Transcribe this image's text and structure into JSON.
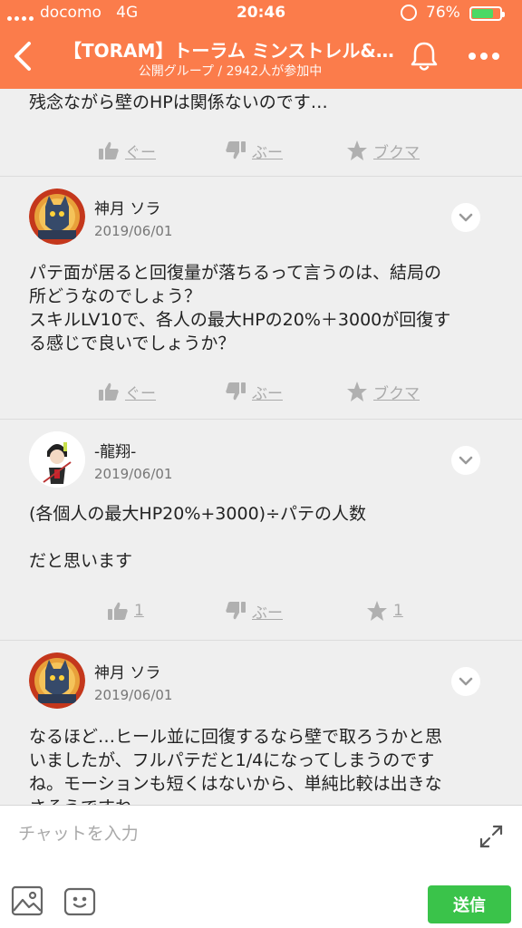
{
  "status": {
    "carrier": "docomo",
    "network": "4G",
    "time": "20:46",
    "battery": "76%",
    "battery_level": 0.76
  },
  "header": {
    "title": "【TORAM】トーラム ミンストレル&…",
    "subtitle": "公開グループ / 2942人が参加中"
  },
  "posts": [
    {
      "body": "残念ながら壁のHPは関係ないのです…",
      "actions": {
        "like": "ぐー",
        "dislike": "ぶー",
        "bookmark": "ブクマ"
      }
    },
    {
      "author": "神月 ソラ",
      "date": "2019/06/01",
      "body_lines": [
        "パテ面が居ると回復量が落ちるって言うのは、結局の",
        "所どうなのでしょう？",
        "スキルLV10で、各人の最大HPの20%＋3000が回復す",
        "る感じで良いでしょうか？"
      ],
      "actions": {
        "like": "ぐー",
        "dislike": "ぶー",
        "bookmark": "ブクマ"
      }
    },
    {
      "author": "-龍翔-",
      "date": "2019/06/01",
      "body_lines": [
        "(各個人の最大HP20%+3000)÷パテの人数",
        "",
        "だと思います"
      ],
      "actions": {
        "like": "1",
        "dislike": "ぶー",
        "bookmark": "1"
      }
    },
    {
      "author": "神月 ソラ",
      "date": "2019/06/01",
      "body_lines": [
        "なるほど…ヒール並に回復するなら壁で取ろうかと思",
        "いましたが、フルパテだと1/4になってしまうのです",
        "ね。モーションも短くはないから、単純比較は出きな",
        "さそうですね"
      ]
    }
  ],
  "composer": {
    "placeholder": "チャットを入力",
    "send_label": "送信"
  },
  "colors": {
    "brand": "#fb7c4b",
    "send": "#3ac34a"
  }
}
